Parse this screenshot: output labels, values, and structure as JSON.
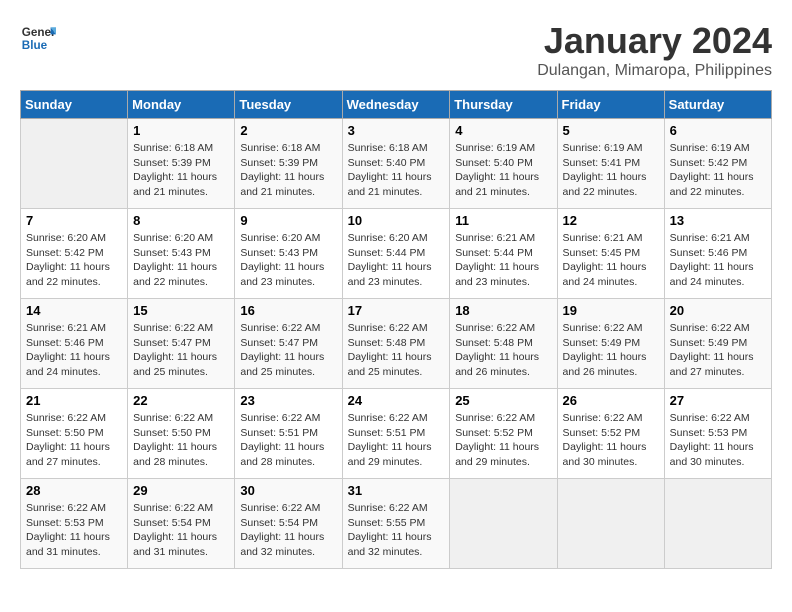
{
  "logo": {
    "line1": "General",
    "line2": "Blue"
  },
  "title": "January 2024",
  "subtitle": "Dulangan, Mimaropa, Philippines",
  "weekdays": [
    "Sunday",
    "Monday",
    "Tuesday",
    "Wednesday",
    "Thursday",
    "Friday",
    "Saturday"
  ],
  "weeks": [
    [
      {
        "day": "",
        "sunrise": "",
        "sunset": "",
        "daylight": ""
      },
      {
        "day": "1",
        "sunrise": "Sunrise: 6:18 AM",
        "sunset": "Sunset: 5:39 PM",
        "daylight": "Daylight: 11 hours and 21 minutes."
      },
      {
        "day": "2",
        "sunrise": "Sunrise: 6:18 AM",
        "sunset": "Sunset: 5:39 PM",
        "daylight": "Daylight: 11 hours and 21 minutes."
      },
      {
        "day": "3",
        "sunrise": "Sunrise: 6:18 AM",
        "sunset": "Sunset: 5:40 PM",
        "daylight": "Daylight: 11 hours and 21 minutes."
      },
      {
        "day": "4",
        "sunrise": "Sunrise: 6:19 AM",
        "sunset": "Sunset: 5:40 PM",
        "daylight": "Daylight: 11 hours and 21 minutes."
      },
      {
        "day": "5",
        "sunrise": "Sunrise: 6:19 AM",
        "sunset": "Sunset: 5:41 PM",
        "daylight": "Daylight: 11 hours and 22 minutes."
      },
      {
        "day": "6",
        "sunrise": "Sunrise: 6:19 AM",
        "sunset": "Sunset: 5:42 PM",
        "daylight": "Daylight: 11 hours and 22 minutes."
      }
    ],
    [
      {
        "day": "7",
        "sunrise": "Sunrise: 6:20 AM",
        "sunset": "Sunset: 5:42 PM",
        "daylight": "Daylight: 11 hours and 22 minutes."
      },
      {
        "day": "8",
        "sunrise": "Sunrise: 6:20 AM",
        "sunset": "Sunset: 5:43 PM",
        "daylight": "Daylight: 11 hours and 22 minutes."
      },
      {
        "day": "9",
        "sunrise": "Sunrise: 6:20 AM",
        "sunset": "Sunset: 5:43 PM",
        "daylight": "Daylight: 11 hours and 23 minutes."
      },
      {
        "day": "10",
        "sunrise": "Sunrise: 6:20 AM",
        "sunset": "Sunset: 5:44 PM",
        "daylight": "Daylight: 11 hours and 23 minutes."
      },
      {
        "day": "11",
        "sunrise": "Sunrise: 6:21 AM",
        "sunset": "Sunset: 5:44 PM",
        "daylight": "Daylight: 11 hours and 23 minutes."
      },
      {
        "day": "12",
        "sunrise": "Sunrise: 6:21 AM",
        "sunset": "Sunset: 5:45 PM",
        "daylight": "Daylight: 11 hours and 24 minutes."
      },
      {
        "day": "13",
        "sunrise": "Sunrise: 6:21 AM",
        "sunset": "Sunset: 5:46 PM",
        "daylight": "Daylight: 11 hours and 24 minutes."
      }
    ],
    [
      {
        "day": "14",
        "sunrise": "Sunrise: 6:21 AM",
        "sunset": "Sunset: 5:46 PM",
        "daylight": "Daylight: 11 hours and 24 minutes."
      },
      {
        "day": "15",
        "sunrise": "Sunrise: 6:22 AM",
        "sunset": "Sunset: 5:47 PM",
        "daylight": "Daylight: 11 hours and 25 minutes."
      },
      {
        "day": "16",
        "sunrise": "Sunrise: 6:22 AM",
        "sunset": "Sunset: 5:47 PM",
        "daylight": "Daylight: 11 hours and 25 minutes."
      },
      {
        "day": "17",
        "sunrise": "Sunrise: 6:22 AM",
        "sunset": "Sunset: 5:48 PM",
        "daylight": "Daylight: 11 hours and 25 minutes."
      },
      {
        "day": "18",
        "sunrise": "Sunrise: 6:22 AM",
        "sunset": "Sunset: 5:48 PM",
        "daylight": "Daylight: 11 hours and 26 minutes."
      },
      {
        "day": "19",
        "sunrise": "Sunrise: 6:22 AM",
        "sunset": "Sunset: 5:49 PM",
        "daylight": "Daylight: 11 hours and 26 minutes."
      },
      {
        "day": "20",
        "sunrise": "Sunrise: 6:22 AM",
        "sunset": "Sunset: 5:49 PM",
        "daylight": "Daylight: 11 hours and 27 minutes."
      }
    ],
    [
      {
        "day": "21",
        "sunrise": "Sunrise: 6:22 AM",
        "sunset": "Sunset: 5:50 PM",
        "daylight": "Daylight: 11 hours and 27 minutes."
      },
      {
        "day": "22",
        "sunrise": "Sunrise: 6:22 AM",
        "sunset": "Sunset: 5:50 PM",
        "daylight": "Daylight: 11 hours and 28 minutes."
      },
      {
        "day": "23",
        "sunrise": "Sunrise: 6:22 AM",
        "sunset": "Sunset: 5:51 PM",
        "daylight": "Daylight: 11 hours and 28 minutes."
      },
      {
        "day": "24",
        "sunrise": "Sunrise: 6:22 AM",
        "sunset": "Sunset: 5:51 PM",
        "daylight": "Daylight: 11 hours and 29 minutes."
      },
      {
        "day": "25",
        "sunrise": "Sunrise: 6:22 AM",
        "sunset": "Sunset: 5:52 PM",
        "daylight": "Daylight: 11 hours and 29 minutes."
      },
      {
        "day": "26",
        "sunrise": "Sunrise: 6:22 AM",
        "sunset": "Sunset: 5:52 PM",
        "daylight": "Daylight: 11 hours and 30 minutes."
      },
      {
        "day": "27",
        "sunrise": "Sunrise: 6:22 AM",
        "sunset": "Sunset: 5:53 PM",
        "daylight": "Daylight: 11 hours and 30 minutes."
      }
    ],
    [
      {
        "day": "28",
        "sunrise": "Sunrise: 6:22 AM",
        "sunset": "Sunset: 5:53 PM",
        "daylight": "Daylight: 11 hours and 31 minutes."
      },
      {
        "day": "29",
        "sunrise": "Sunrise: 6:22 AM",
        "sunset": "Sunset: 5:54 PM",
        "daylight": "Daylight: 11 hours and 31 minutes."
      },
      {
        "day": "30",
        "sunrise": "Sunrise: 6:22 AM",
        "sunset": "Sunset: 5:54 PM",
        "daylight": "Daylight: 11 hours and 32 minutes."
      },
      {
        "day": "31",
        "sunrise": "Sunrise: 6:22 AM",
        "sunset": "Sunset: 5:55 PM",
        "daylight": "Daylight: 11 hours and 32 minutes."
      },
      {
        "day": "",
        "sunrise": "",
        "sunset": "",
        "daylight": ""
      },
      {
        "day": "",
        "sunrise": "",
        "sunset": "",
        "daylight": ""
      },
      {
        "day": "",
        "sunrise": "",
        "sunset": "",
        "daylight": ""
      }
    ]
  ]
}
